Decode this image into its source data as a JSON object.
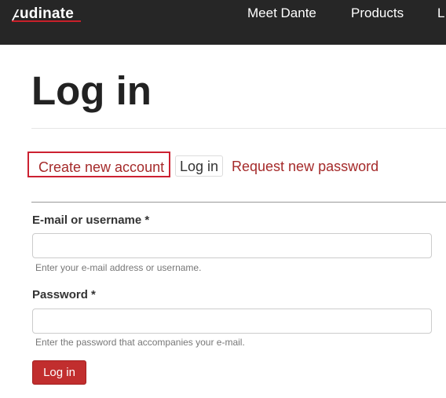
{
  "header": {
    "logo_text": "udinate",
    "nav": [
      "Meet Dante",
      "Products",
      "L"
    ],
    "colors": {
      "background": "#262626",
      "accent": "#c8202a"
    }
  },
  "page": {
    "title": "Log in"
  },
  "tabs": {
    "create": "Create new account",
    "login": "Log in",
    "request": "Request new password"
  },
  "form": {
    "username": {
      "label": "E-mail or username *",
      "value": "",
      "help": "Enter your e-mail address or username."
    },
    "password": {
      "label": "Password *",
      "value": "",
      "help": "Enter the password that accompanies your e-mail."
    },
    "submit_label": "Log in",
    "colors": {
      "button": "#c12e2e",
      "link": "#a52a2a"
    }
  }
}
